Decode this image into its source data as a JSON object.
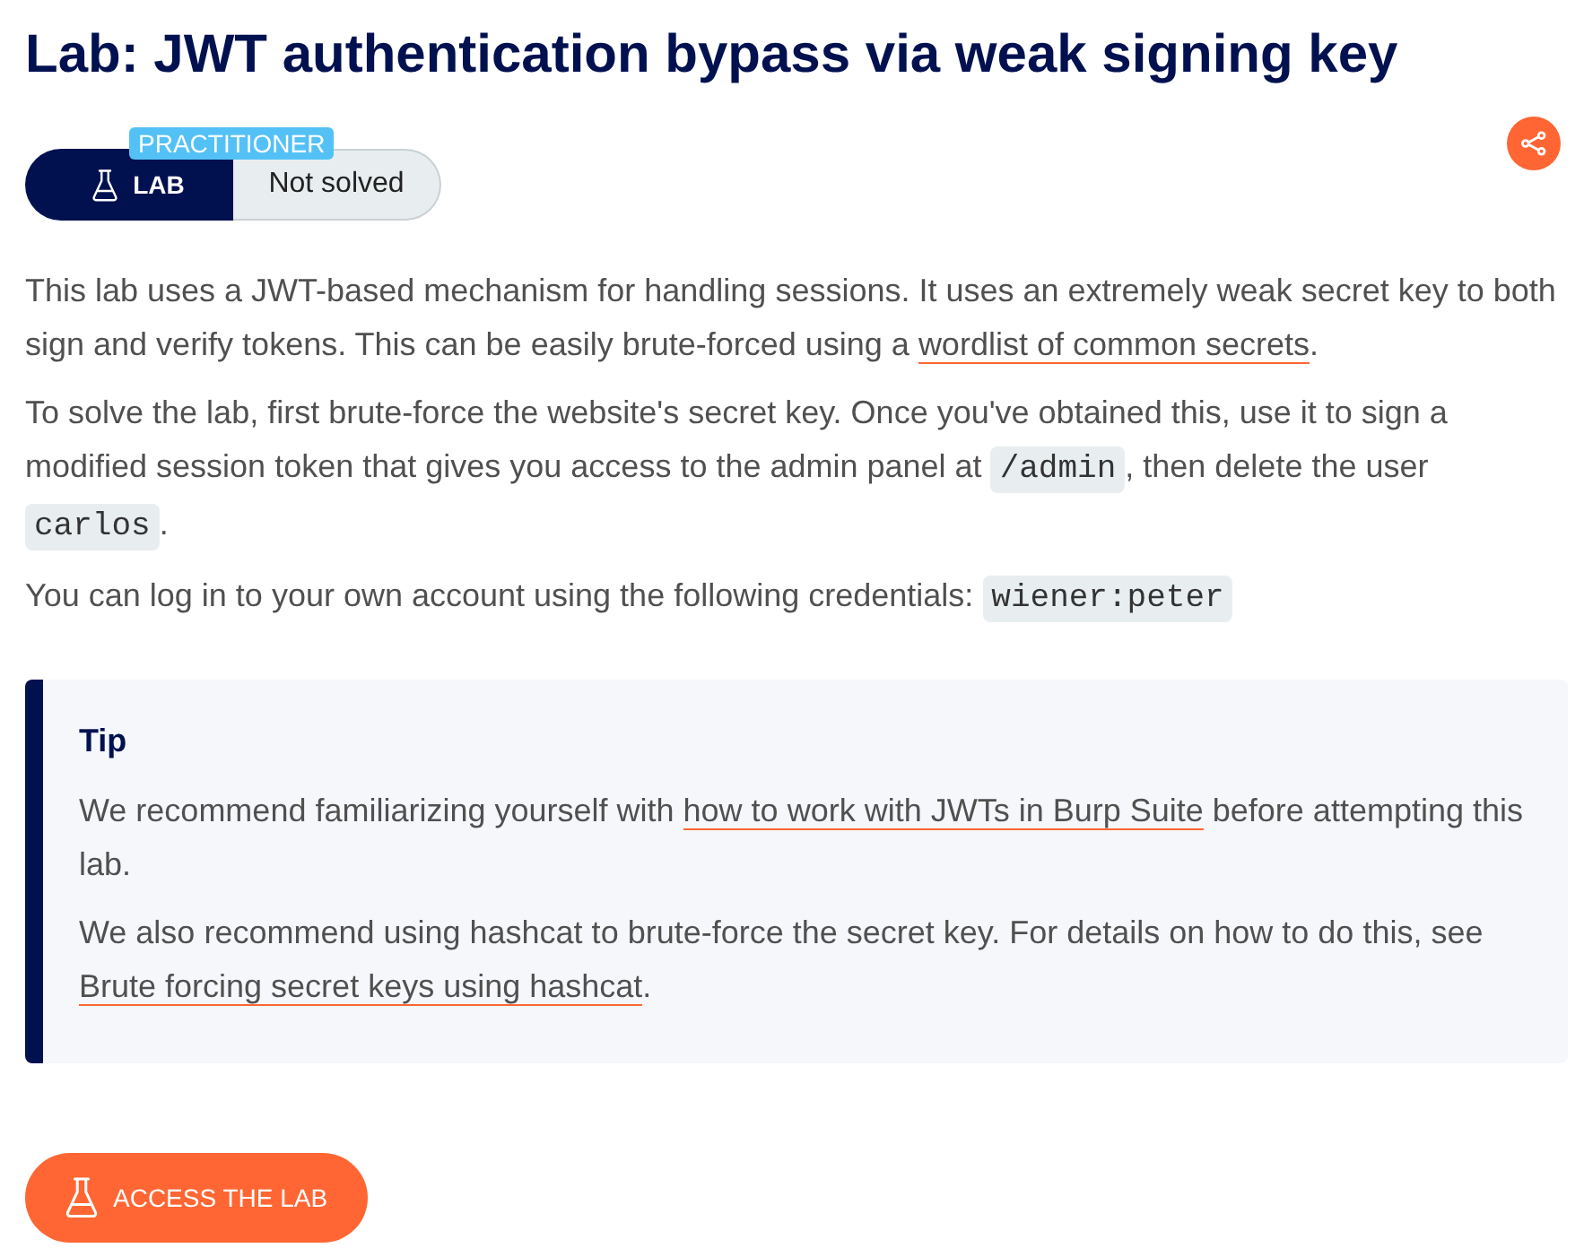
{
  "page_title": "Lab: JWT authentication bypass via weak signing key",
  "lab_badge": {
    "difficulty": "PRACTITIONER",
    "type": "LAB",
    "status": "Not solved"
  },
  "description": [
    {
      "parts": [
        {
          "kind": "text",
          "text": "This lab uses a JWT-based mechanism for handling sessions. It uses an extremely weak secret key to both sign and verify tokens. This can be easily brute-forced using a "
        },
        {
          "kind": "link",
          "text": "wordlist of common secrets"
        },
        {
          "kind": "text",
          "text": "."
        }
      ]
    },
    {
      "parts": [
        {
          "kind": "text",
          "text": "To solve the lab, first brute-force the website's secret key. Once you've obtained this, use it to sign a modified session token that gives you access to the admin panel at "
        },
        {
          "kind": "code",
          "text": "/admin"
        },
        {
          "kind": "text",
          "text": ", then delete the user "
        },
        {
          "kind": "code",
          "text": "carlos"
        },
        {
          "kind": "text",
          "text": "."
        }
      ]
    },
    {
      "parts": [
        {
          "kind": "text",
          "text": "You can log in to your own account using the following credentials: "
        },
        {
          "kind": "code",
          "text": "wiener:peter"
        }
      ]
    }
  ],
  "tip": {
    "heading": "Tip",
    "paragraphs": [
      {
        "parts": [
          {
            "kind": "text",
            "text": "We recommend familiarizing yourself with "
          },
          {
            "kind": "link",
            "text": "how to work with JWTs in Burp Suite"
          },
          {
            "kind": "text",
            "text": " before attempting this lab."
          }
        ]
      },
      {
        "parts": [
          {
            "kind": "text",
            "text": "We also recommend using hashcat to brute-force the secret key. For details on how to do this, see "
          },
          {
            "kind": "link",
            "text": "Brute forcing secret keys using hashcat"
          },
          {
            "kind": "text",
            "text": "."
          }
        ]
      }
    ]
  },
  "access_button": {
    "label": "ACCESS THE LAB"
  }
}
